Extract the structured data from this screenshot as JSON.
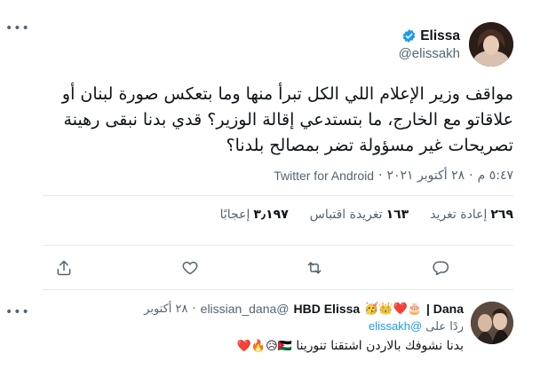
{
  "tweet": {
    "display_name": "Elissa",
    "handle": "@elissakh",
    "text": "مواقف وزير الإعلام اللي الكل تبرأ منها وما بتعكس صورة لبنان أو علاقاتو مع الخارج، ما بتستدعي إقالة الوزير؟ قدي بدنا نبقى رهينة تصريحات  غير مسؤولة تضر بمصالح بلدنا؟",
    "time": "٥:٤٧ م",
    "date": "٢٨ أكتوبر ٢٠٢١",
    "source": "Twitter for Android",
    "separator": "·"
  },
  "stats": {
    "retweets_count": "٢٦٩",
    "retweets_label": "إعادة تغريد",
    "quotes_count": "١٦٣",
    "quotes_label": "تغريدة اقتباس",
    "likes_count": "٣٫١٩٧",
    "likes_label": "إعجابًا"
  },
  "actions": {
    "reply_icon": "reply-icon",
    "retweet_icon": "retweet-icon",
    "like_icon": "heart-icon",
    "share_icon": "share-icon"
  },
  "reply": {
    "name_part1": "Dana |",
    "emojis_name": "🎂❤️👑🥳",
    "name_part2": "HBD Elissa",
    "handle": "@elissian_dana",
    "separator": "·",
    "date": "٢٨ أكتوبر",
    "replying_prefix": "ردًا على",
    "replying_to": "@elissakh",
    "text": "بدنا نشوفك بالاردن اشتقنا تنورينا",
    "text_emojis": "🇯🇴😥🔥❤️"
  },
  "colors": {
    "accent": "#1d9bf0",
    "secondary_text": "#536471",
    "divider": "#e5e9ec"
  }
}
